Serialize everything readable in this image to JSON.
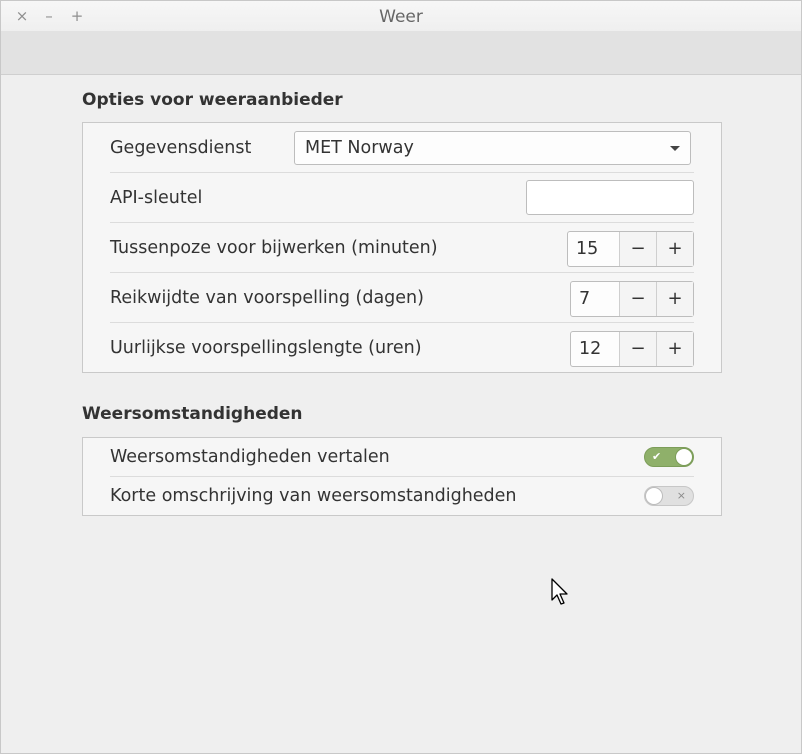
{
  "window": {
    "title": "Weer",
    "close_glyph": "×",
    "minimize_glyph": "–",
    "maximize_glyph": "+"
  },
  "provider_section": {
    "title": "Opties voor weeraanbieder",
    "rows": {
      "data_service": {
        "label": "Gegevensdienst",
        "value": "MET Norway"
      },
      "api_key": {
        "label": "API-sleutel",
        "value": ""
      },
      "refresh_interval": {
        "label": "Tussenpoze voor bijwerken (minuten)",
        "value": "15"
      },
      "forecast_range": {
        "label": "Reikwijdte van voorspelling (dagen)",
        "value": "7"
      },
      "hourly_length": {
        "label": "Uurlijkse voorspellingslengte (uren)",
        "value": "12"
      }
    },
    "minus_glyph": "−",
    "plus_glyph": "+"
  },
  "conditions_section": {
    "title": "Weersomstandigheden",
    "rows": {
      "translate": {
        "label": "Weersomstandigheden vertalen",
        "enabled": true,
        "glyph": "✔"
      },
      "short_desc": {
        "label": "Korte omschrijving van weersomstandigheden",
        "enabled": false,
        "glyph": "×"
      }
    }
  },
  "colors": {
    "switch_on": "#8fb06a",
    "switch_off": "#e0e0e0",
    "background": "#efefef"
  }
}
